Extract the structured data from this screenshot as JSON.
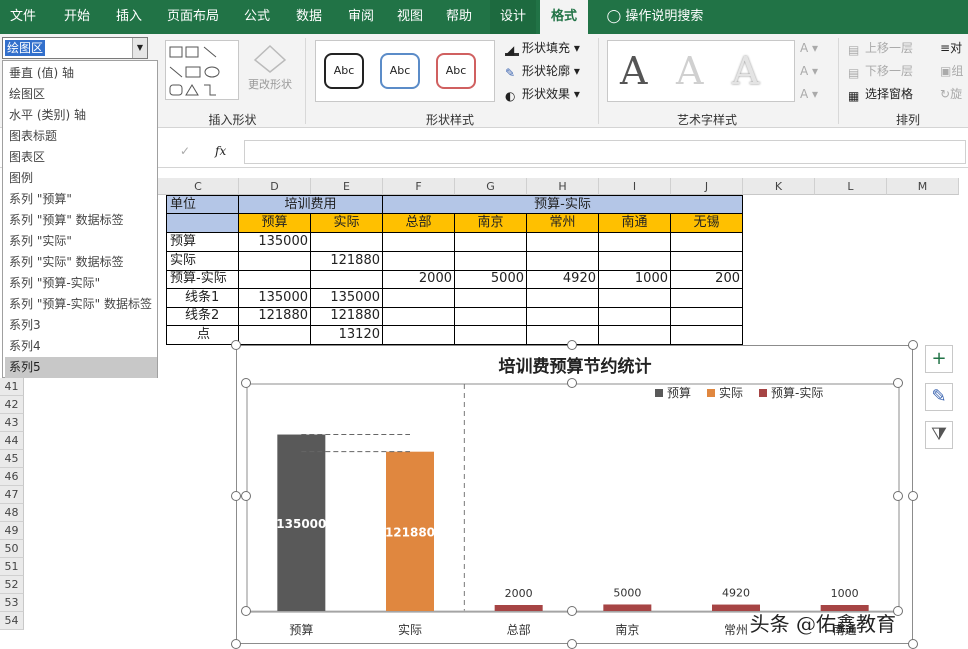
{
  "ribbon_tabs": [
    "文件",
    "开始",
    "插入",
    "页面布局",
    "公式",
    "数据",
    "审阅",
    "视图",
    "帮助",
    "设计",
    "格式",
    "操作说明搜索"
  ],
  "ribbon": {
    "change_shape": "更改形状",
    "insert_shapes": "插入形状",
    "shape_styles": "形状样式",
    "abc": "Abc",
    "shape_fill": "形状填充",
    "shape_outline": "形状轮廓",
    "shape_effects": "形状效果",
    "wordart_styles": "艺术字样式",
    "wordart_letter": "A",
    "bring_forward": "上移一层",
    "send_backward": "下移一层",
    "selection_pane": "选择窗格",
    "align_short": "对",
    "group_short": "组",
    "rotate_short": "旋",
    "arrange": "排列"
  },
  "name_box": {
    "value": "绘图区"
  },
  "formula_bar": {
    "fx": "fx"
  },
  "dropdown_items": [
    "垂直 (值) 轴",
    "绘图区",
    "水平 (类别) 轴",
    "图表标题",
    "图表区",
    "图例",
    "系列 \"预算\"",
    "系列 \"预算\" 数据标签",
    "系列 \"实际\"",
    "系列 \"实际\" 数据标签",
    "系列 \"预算-实际\"",
    "系列 \"预算-实际\" 数据标签",
    "系列3",
    "系列4",
    "系列5"
  ],
  "dropdown_selected_index": 14,
  "columns": [
    "C",
    "D",
    "E",
    "F",
    "G",
    "H",
    "I",
    "J",
    "K",
    "L",
    "M"
  ],
  "row_numbers": [
    "41",
    "42",
    "43",
    "44",
    "45",
    "46",
    "47",
    "48",
    "49",
    "50",
    "51",
    "52",
    "53",
    "54"
  ],
  "table": {
    "h1": {
      "unit": "单位",
      "training": "培训费用",
      "budget_actual": "预算-实际"
    },
    "h2": [
      "预算",
      "实际",
      "总部",
      "南京",
      "常州",
      "南通",
      "无锡"
    ],
    "rows": [
      {
        "label": "预算",
        "D": "135000",
        "E": "",
        "F": "",
        "G": "",
        "H": "",
        "I": "",
        "J": ""
      },
      {
        "label": "实际",
        "D": "",
        "E": "121880",
        "F": "",
        "G": "",
        "H": "",
        "I": "",
        "J": ""
      },
      {
        "label": "预算-实际",
        "D": "",
        "E": "",
        "F": "2000",
        "G": "5000",
        "H": "4920",
        "I": "1000",
        "J": "200"
      },
      {
        "label": "线条1",
        "D": "135000",
        "E": "135000",
        "F": "",
        "G": "",
        "H": "",
        "I": "",
        "J": ""
      },
      {
        "label": "线条2",
        "D": "121880",
        "E": "121880",
        "F": "",
        "G": "",
        "H": "",
        "I": "",
        "J": ""
      },
      {
        "label": "点",
        "D": "",
        "E": "13120",
        "F": "",
        "G": "",
        "H": "",
        "I": "",
        "J": ""
      }
    ]
  },
  "chart_data": {
    "type": "bar",
    "title": "培训费预算节约统计",
    "categories": [
      "预算",
      "实际",
      "总部",
      "南京",
      "常州",
      "南通"
    ],
    "series": [
      {
        "name": "预算",
        "color": "#595959",
        "values": [
          135000,
          null,
          null,
          null,
          null,
          null
        ]
      },
      {
        "name": "实际",
        "color": "#e0873f",
        "values": [
          null,
          121880,
          null,
          null,
          null,
          null
        ]
      },
      {
        "name": "预算-实际",
        "color": "#a64444",
        "values": [
          null,
          null,
          2000,
          5000,
          4920,
          1000
        ]
      }
    ],
    "data_labels": [
      "135000",
      "121880",
      "2000",
      "5000",
      "4920",
      "1000"
    ],
    "ylim": [
      0,
      140000
    ],
    "legend_position": "top-right",
    "reference_lines": [
      135000,
      121880
    ]
  },
  "chart_buttons": {
    "add": "+",
    "style": "✎",
    "filter": "⧩"
  },
  "watermark": "头条 @佑鑫教育"
}
